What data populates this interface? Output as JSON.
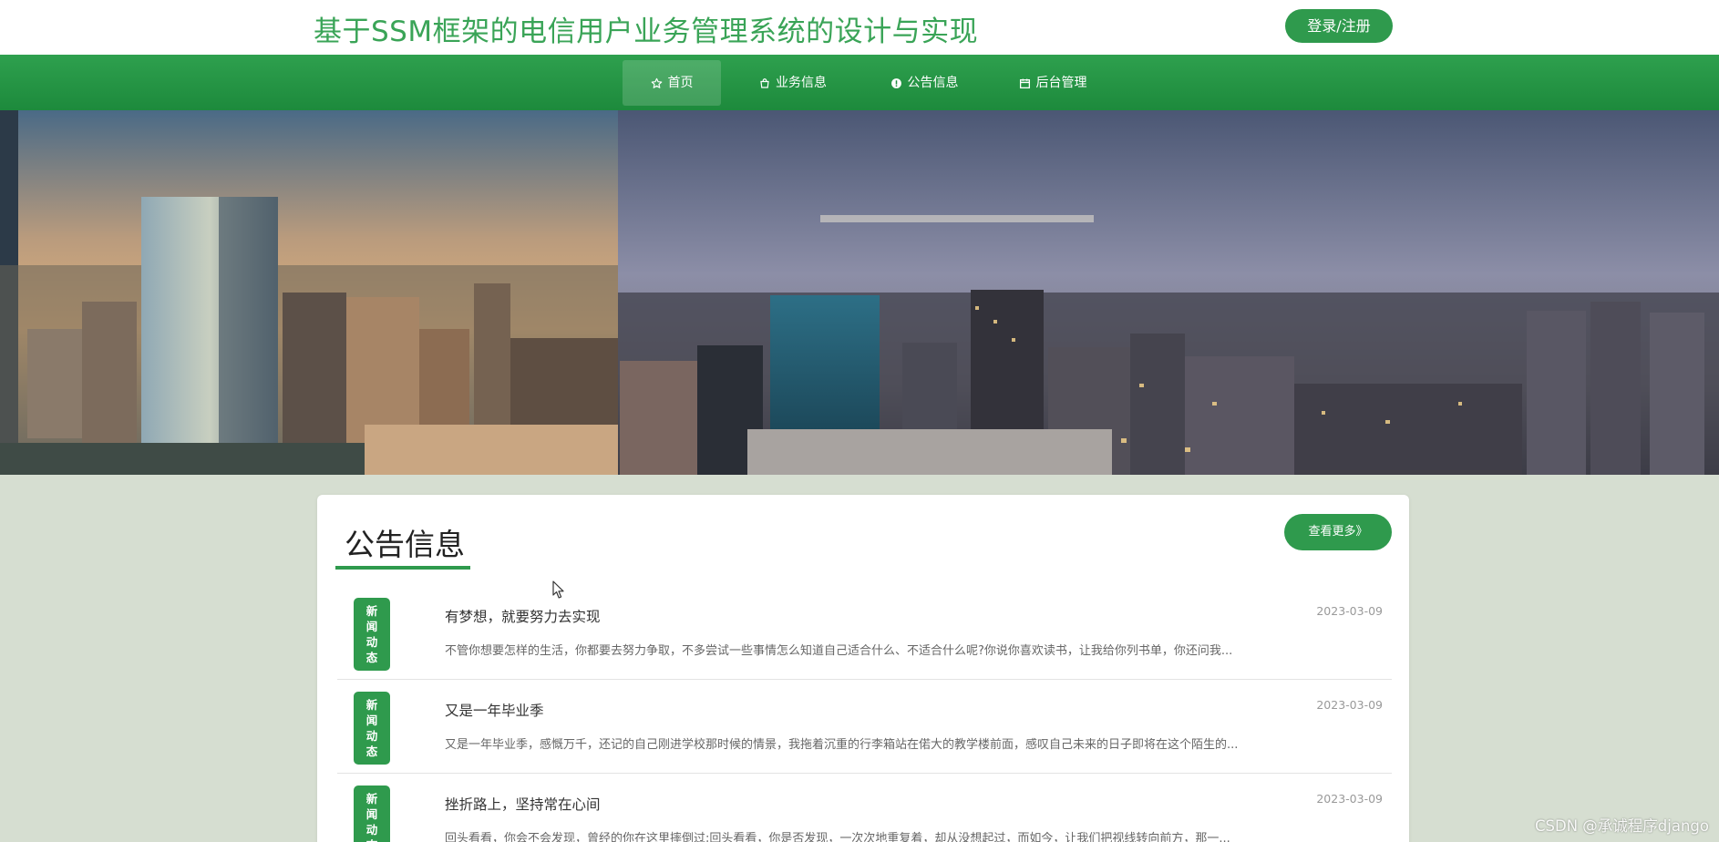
{
  "header": {
    "site_title": "基于SSM框架的电信用户业务管理系统的设计与实现",
    "login_label": "登录/注册"
  },
  "nav": {
    "items": [
      {
        "label": "首页",
        "icon": "star-icon",
        "active": true
      },
      {
        "label": "业务信息",
        "icon": "bag-icon",
        "active": false
      },
      {
        "label": "公告信息",
        "icon": "info-circle-icon",
        "active": false
      },
      {
        "label": "后台管理",
        "icon": "calendar-icon",
        "active": false
      }
    ]
  },
  "banner": {
    "image_subject": "city-skyline-photo"
  },
  "notice": {
    "title": "公告信息",
    "more_label": "查看更多》",
    "items": [
      {
        "badge": "新\n闻\n动\n态",
        "title": "有梦想，就要努力去实现",
        "summary": "不管你想要怎样的生活，你都要去努力争取，不多尝试一些事情怎么知道自己适合什么、不适合什么呢?你说你喜欢读书，让我给你列书单，你还问我...",
        "date": "2023-03-09"
      },
      {
        "badge": "新\n闻\n动\n态",
        "title": "又是一年毕业季",
        "summary": "又是一年毕业季，感慨万千，还记的自己刚进学校那时候的情景，我拖着沉重的行李箱站在偌大的教学楼前面，感叹自己未来的日子即将在这个陌生的...",
        "date": "2023-03-09"
      },
      {
        "badge": "新\n闻\n动\n态",
        "title": "挫折路上，坚持常在心间",
        "summary": "回头看看，你会不会发现，曾经的你在这里摔倒过;回头看看，你是否发现，一次次地重复着，却从没想起过，而如今，让我们把视线转向前方，那一...",
        "date": "2023-03-09"
      }
    ]
  },
  "watermark": "CSDN @承诚程序django",
  "colors": {
    "brand_green": "#2f9a4d",
    "title_green": "#3aa457",
    "page_bg": "#d6ded1"
  }
}
